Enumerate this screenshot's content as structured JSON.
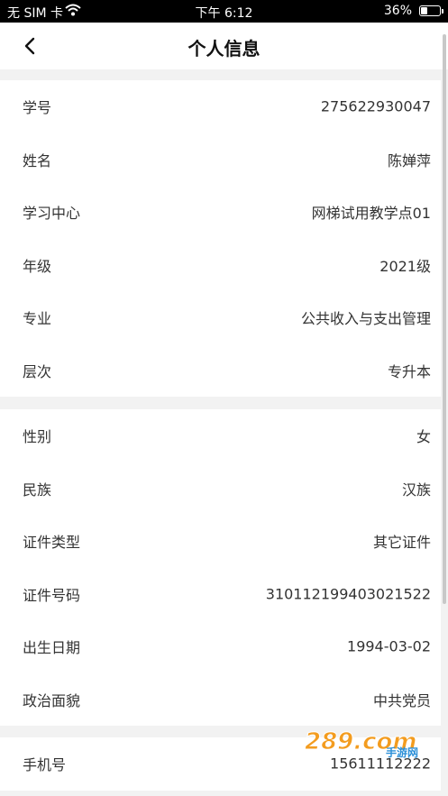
{
  "status_bar": {
    "carrier": "无 SIM 卡",
    "time": "下午 6:12",
    "battery": "36%",
    "battery_level": 0.36
  },
  "nav": {
    "title": "个人信息",
    "back_icon": "chevron-left-icon"
  },
  "sections": [
    {
      "rows": [
        {
          "label": "学号",
          "value": "275622930047"
        },
        {
          "label": "姓名",
          "value": "陈婵萍"
        },
        {
          "label": "学习中心",
          "value": "网梯试用教学点01"
        },
        {
          "label": "年级",
          "value": "2021级"
        },
        {
          "label": "专业",
          "value": "公共收入与支出管理"
        },
        {
          "label": "层次",
          "value": "专升本"
        }
      ]
    },
    {
      "rows": [
        {
          "label": "性别",
          "value": "女"
        },
        {
          "label": "民族",
          "value": "汉族"
        },
        {
          "label": "证件类型",
          "value": "其它证件"
        },
        {
          "label": "证件号码",
          "value": "310112199403021522"
        },
        {
          "label": "出生日期",
          "value": "1994-03-02"
        },
        {
          "label": "政治面貌",
          "value": "中共党员"
        }
      ]
    },
    {
      "rows": [
        {
          "label": "手机号",
          "value": "15611112222"
        }
      ]
    }
  ],
  "watermark": {
    "text": "289.com",
    "subtext": "手游网",
    "colors": {
      "primary": "#f39c1f",
      "secondary": "#2a8fd8"
    }
  }
}
